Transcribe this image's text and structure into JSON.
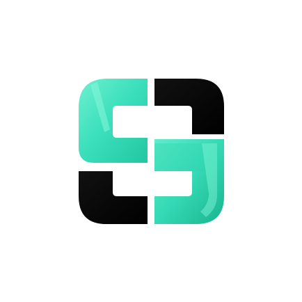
{
  "logo": {
    "icon": "s-monogram-logo-icon",
    "colors": {
      "teal": "#3de0bd",
      "teal_light": "#6ff0d0",
      "teal_dark": "#1fbf9a",
      "black": "#000000",
      "background": "#ffffff"
    }
  }
}
